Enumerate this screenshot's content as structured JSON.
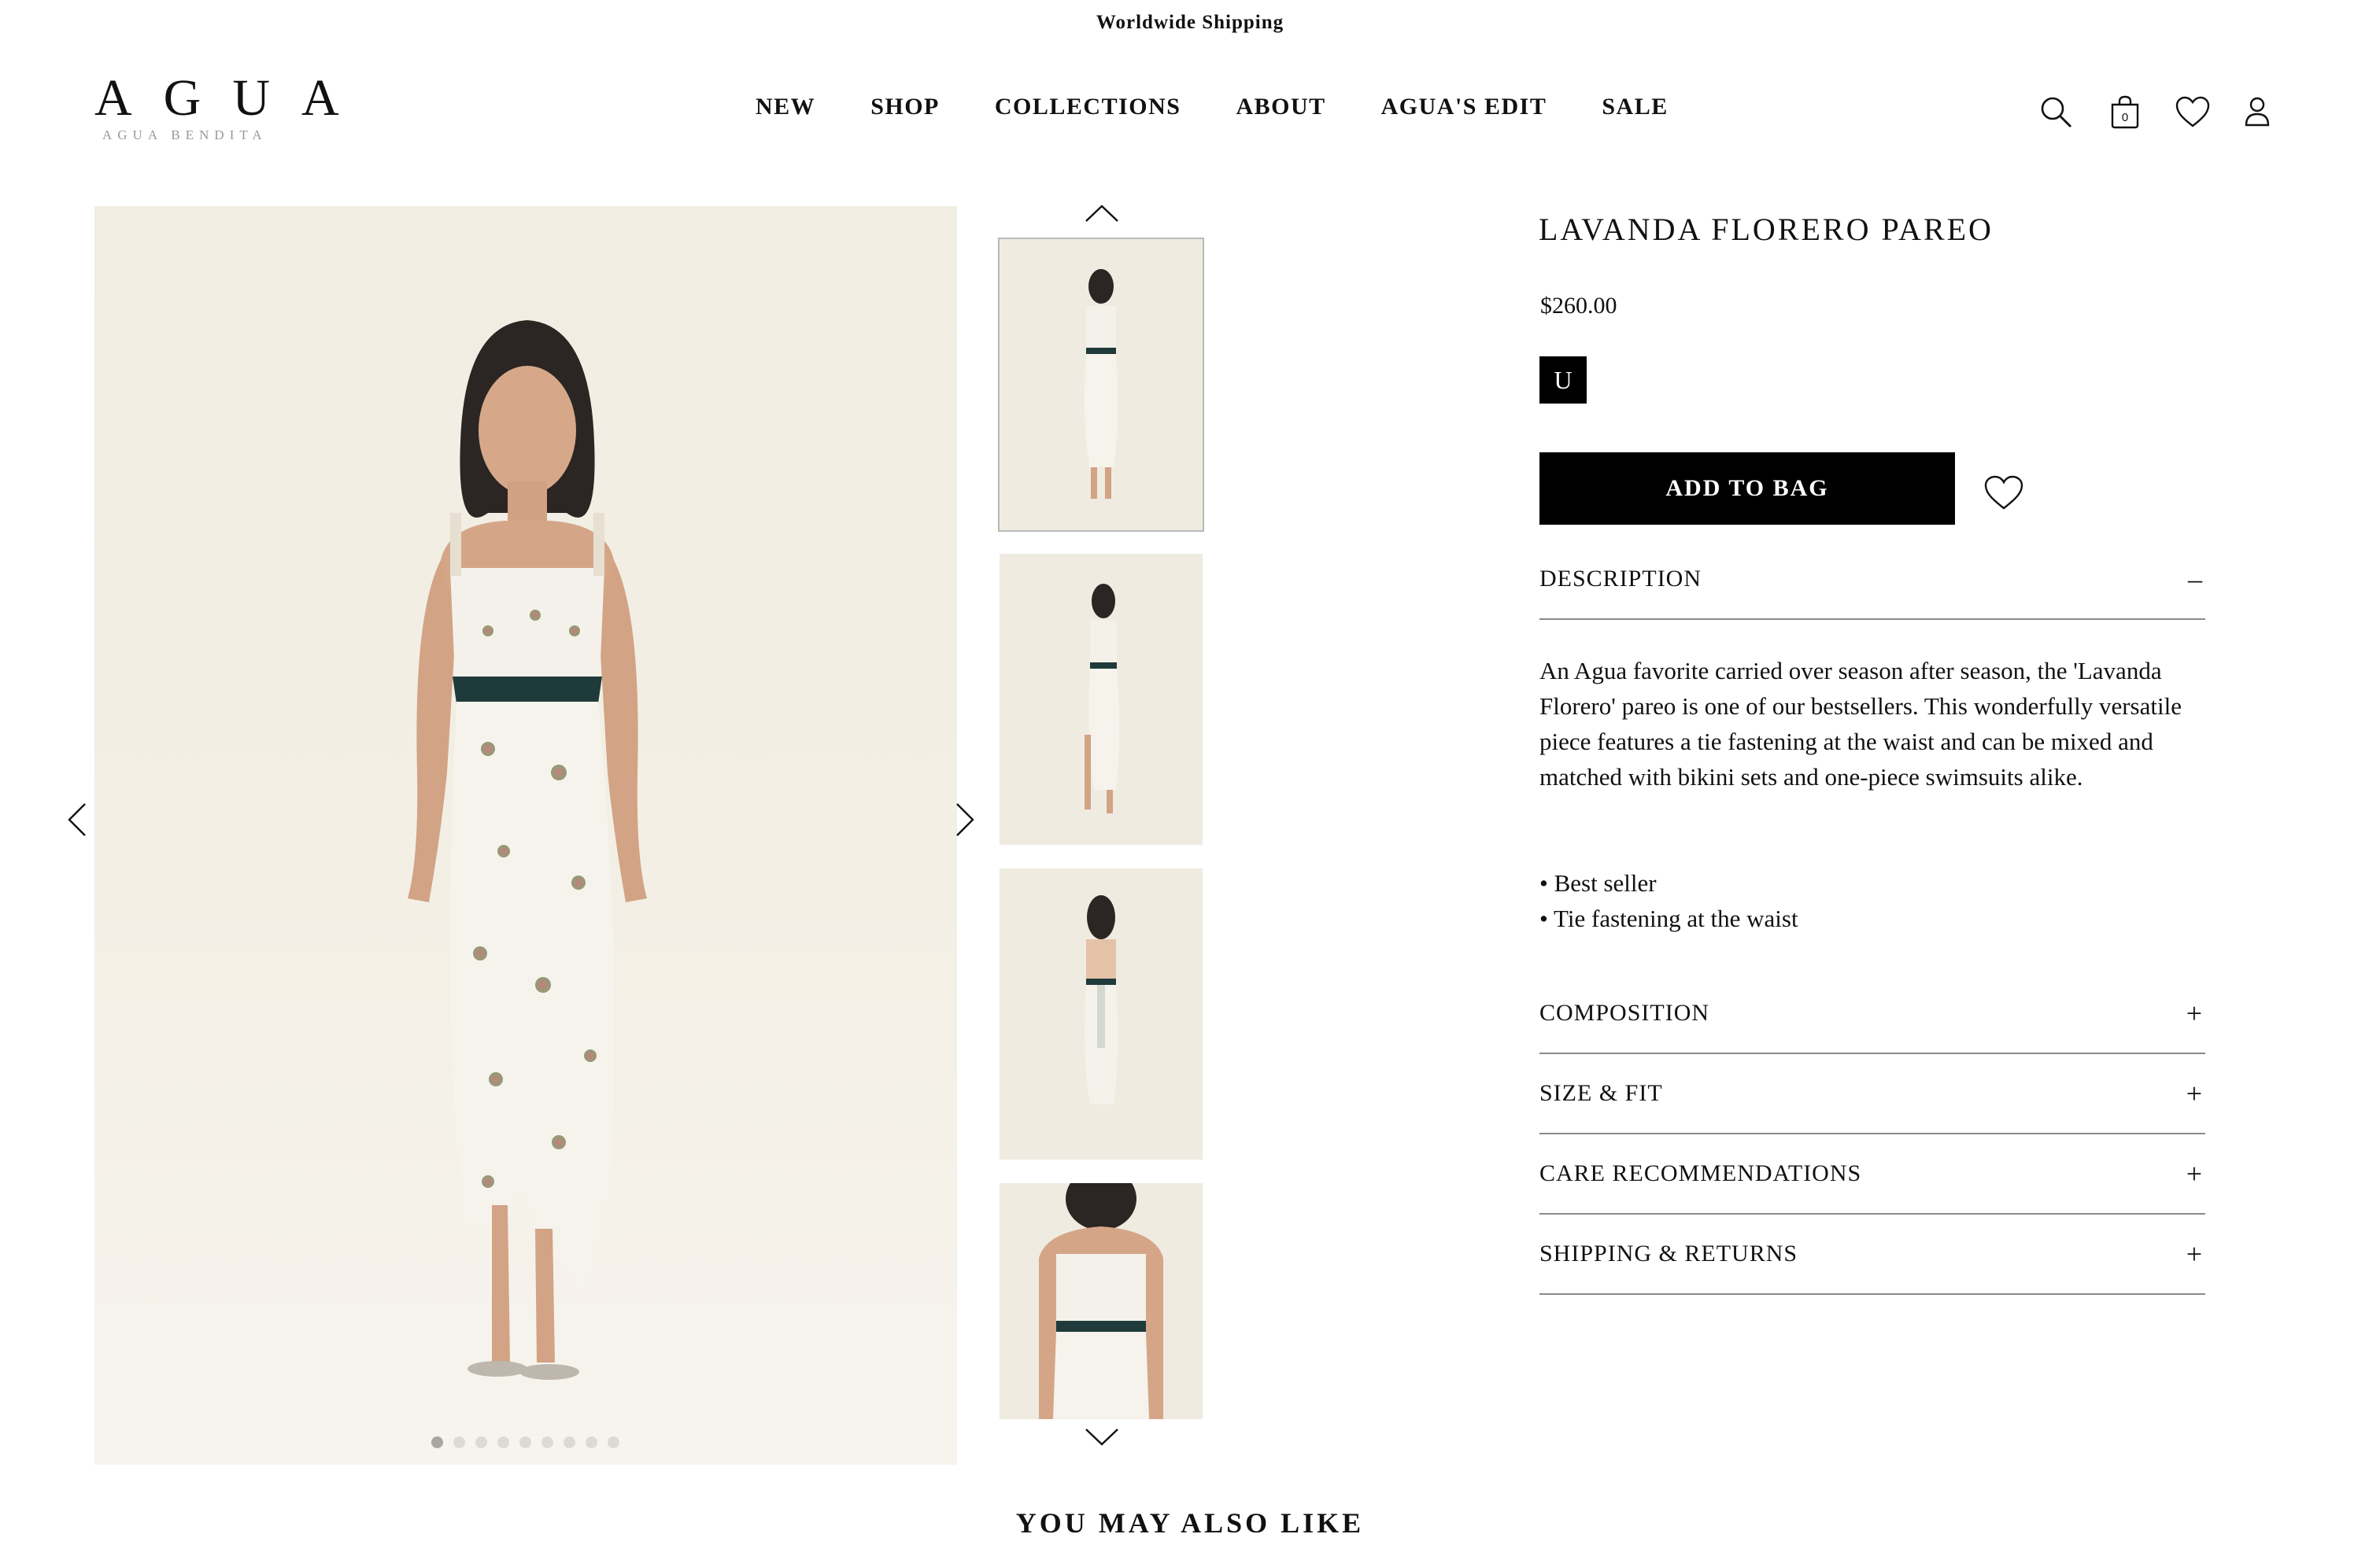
{
  "banner": {
    "text": "Worldwide Shipping"
  },
  "brand": {
    "logo_main": "AGUA",
    "logo_sub": "AGUA BENDITA"
  },
  "nav": {
    "items": [
      "NEW",
      "SHOP",
      "COLLECTIONS",
      "ABOUT",
      "AGUA'S EDIT",
      "SALE"
    ]
  },
  "header_icons": {
    "search": "search-icon",
    "bag": "bag-icon",
    "bag_count": "0",
    "wishlist": "heart-icon",
    "account": "user-icon"
  },
  "gallery": {
    "total_images": 9,
    "active_index": 0,
    "thumbnails_visible": 4,
    "selected_thumbnail": 0
  },
  "product": {
    "title": "LAVANDA FLORERO PAREO",
    "price": "$260.00",
    "size": "U",
    "add_to_bag": "ADD TO BAG"
  },
  "accordion": {
    "description": {
      "title": "DESCRIPTION",
      "sign": "–"
    },
    "description_text": "An Agua favorite carried over season after season, the 'Lavanda Florero' pareo is one of our bestsellers. This wonderfully versatile piece features a tie fastening at the waist and can be mixed and matched with bikini sets and one-piece swimsuits alike.",
    "bullets": [
      "• Best seller",
      "• Tie fastening at the waist"
    ],
    "items": [
      {
        "title": "COMPOSITION",
        "sign": "+"
      },
      {
        "title": "SIZE & FIT",
        "sign": "+"
      },
      {
        "title": "CARE RECOMMENDATIONS",
        "sign": "+"
      },
      {
        "title": "SHIPPING & RETURNS",
        "sign": "+"
      }
    ]
  },
  "recommendations": {
    "title": "YOU MAY ALSO LIKE"
  },
  "colors": {
    "background": "#ffffff",
    "text": "#111111",
    "button": "#000000",
    "image_bg": "#f1ede2",
    "divider": "#8a8a8a"
  }
}
